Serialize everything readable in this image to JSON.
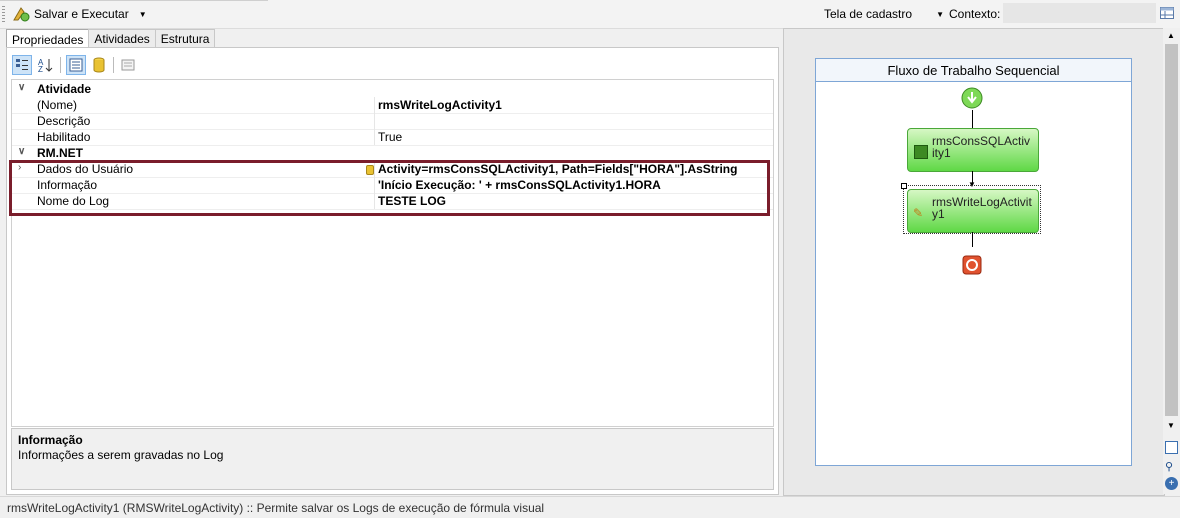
{
  "toolbar": {
    "run_label": "Salvar e Executar",
    "form_value": "Tela de cadastro",
    "context_label": "Contexto:"
  },
  "tabs": [
    {
      "label": "Propriedades"
    },
    {
      "label": "Atividades"
    },
    {
      "label": "Estrutura"
    }
  ],
  "grid": {
    "categories": {
      "atividade": "Atividade",
      "rmnet": "RM.NET"
    },
    "rows": {
      "nome": {
        "name": "(Nome)",
        "value": "rmsWriteLogActivity1"
      },
      "descricao": {
        "name": "Descrição",
        "value": ""
      },
      "habilitado": {
        "name": "Habilitado",
        "value": "True"
      },
      "dados": {
        "name": "Dados do Usuário",
        "value": "Activity=rmsConsSQLActivity1, Path=Fields[\"HORA\"].AsString"
      },
      "informacao": {
        "name": "Informação",
        "value": "'Início Execução: ' + rmsConsSQLActivity1.HORA"
      },
      "nomelog": {
        "name": "Nome do Log",
        "value": "TESTE LOG"
      }
    }
  },
  "help": {
    "title": "Informação",
    "description": "Informações a serem gravadas no Log"
  },
  "workflow": {
    "title": "Fluxo de Trabalho Sequencial",
    "activities": [
      {
        "label": "rmsConsSQLActivity1"
      },
      {
        "label": "rmsWriteLogActivity1"
      }
    ]
  },
  "status": "rmsWriteLogActivity1  (RMSWriteLogActivity)  :: Permite salvar os Logs de execução de fórmula visual",
  "colors": {
    "highlight": "#7a1d2b",
    "activity": "#5fd845",
    "accent": "#7ea6d6"
  },
  "icons": [
    "run-icon",
    "categorized-icon",
    "alphabetical-icon",
    "properties-icon",
    "database-icon",
    "events-icon",
    "grid-view-icon",
    "start-icon",
    "stop-icon",
    "zoom-icon"
  ]
}
